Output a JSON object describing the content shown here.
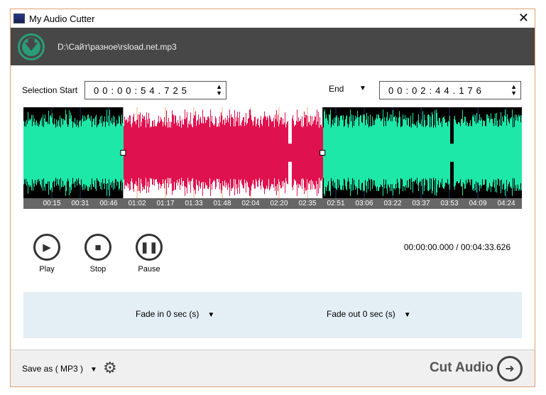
{
  "window": {
    "title": "My Audio Cutter",
    "close": "✕"
  },
  "file": {
    "path": "D:\\Сайт\\разное\\rsload.net.mp3"
  },
  "selection": {
    "start_label": "Selection Start",
    "start_value": "00:00:54.725",
    "end_label": "End",
    "end_value": "00:02:44.176"
  },
  "timeline": {
    "ticks": [
      "00:15",
      "00:31",
      "00:46",
      "01:02",
      "01:17",
      "01:33",
      "01:48",
      "02:04",
      "02:20",
      "02:35",
      "02:51",
      "03:06",
      "03:22",
      "03:37",
      "03:53",
      "04:09",
      "04:24"
    ]
  },
  "waveform": {
    "duration_s": 273.626,
    "selection_start_s": 54.725,
    "selection_end_s": 164.176,
    "colors": {
      "unselected": "#1ee8a8",
      "selected": "#e0114f"
    }
  },
  "controls": {
    "play": "Play",
    "stop": "Stop",
    "pause": "Pause"
  },
  "time_display": "00:00:00.000 / 00:04:33.626",
  "fade": {
    "in": "Fade in 0 sec (s)",
    "out": "Fade out 0 sec (s)"
  },
  "footer": {
    "save_as": "Save as ( MP3 )",
    "cut": "Cut Audio"
  }
}
